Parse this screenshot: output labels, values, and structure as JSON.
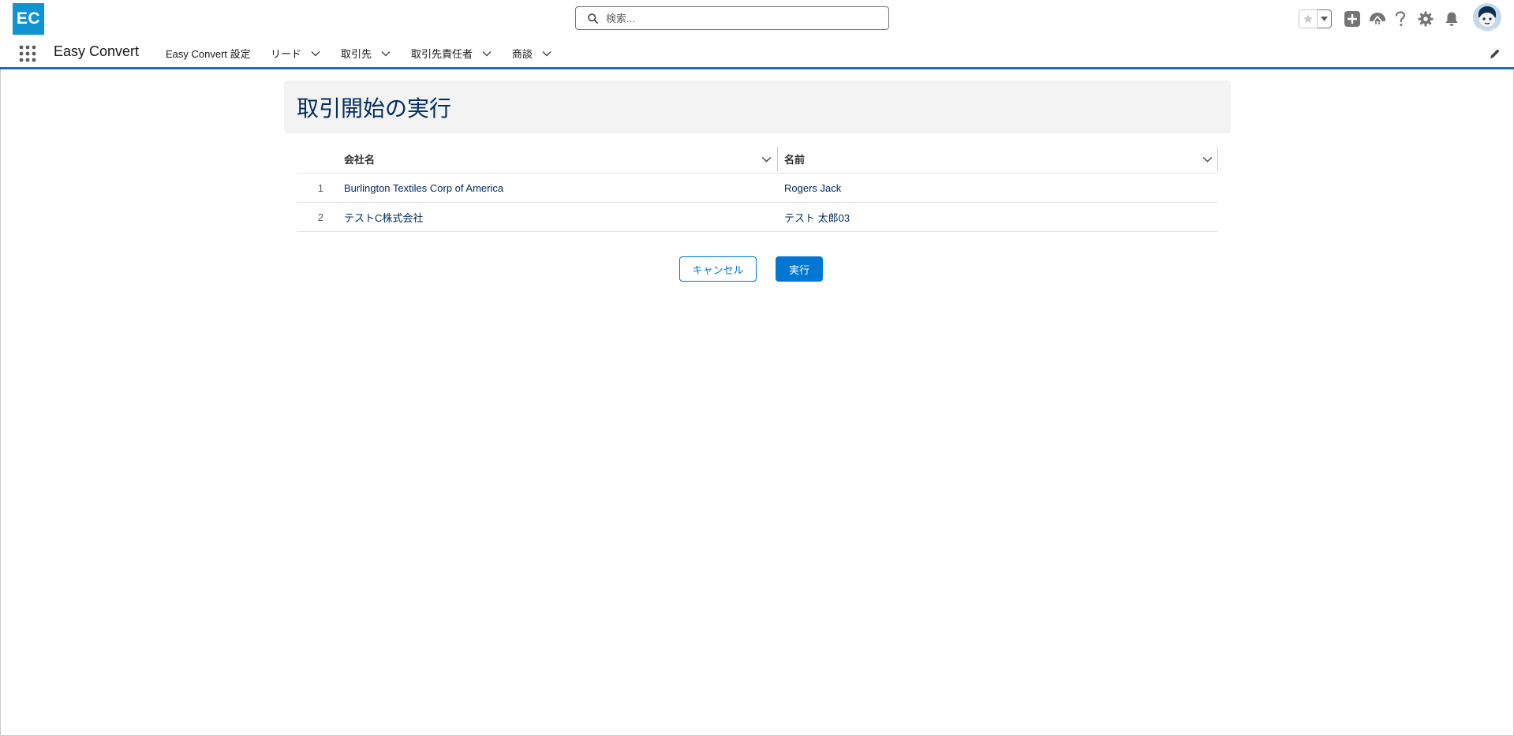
{
  "app": {
    "logo_text": "EC",
    "logo_color": "#0f93d1",
    "name": "Easy Convert"
  },
  "search": {
    "placeholder": "検索...",
    "value": ""
  },
  "utility_icons": [
    "favorite-star-icon",
    "favorites-dropdown-icon",
    "global-actions-add-icon",
    "trailhead-icon",
    "help-icon",
    "setup-gear-icon",
    "notifications-bell-icon",
    "user-avatar"
  ],
  "nav": {
    "items": [
      {
        "label": "Easy Convert 設定",
        "has_menu": false
      },
      {
        "label": "リード",
        "has_menu": true
      },
      {
        "label": "取引先",
        "has_menu": true
      },
      {
        "label": "取引先責任者",
        "has_menu": true
      },
      {
        "label": "商談",
        "has_menu": true
      }
    ],
    "accent_color": "#1b6fbb"
  },
  "page": {
    "title": "取引開始の実行",
    "title_color": "#032d60"
  },
  "table": {
    "columns": [
      "会社名",
      "名前"
    ],
    "rows": [
      {
        "num": "1",
        "company": "Burlington Textiles Corp of America",
        "name": "Rogers Jack"
      },
      {
        "num": "2",
        "company": "テストC株式会社",
        "name": "テスト 太郎03"
      }
    ]
  },
  "actions": {
    "cancel_label": "キャンセル",
    "run_label": "実行",
    "brand_color": "#0176d3"
  }
}
